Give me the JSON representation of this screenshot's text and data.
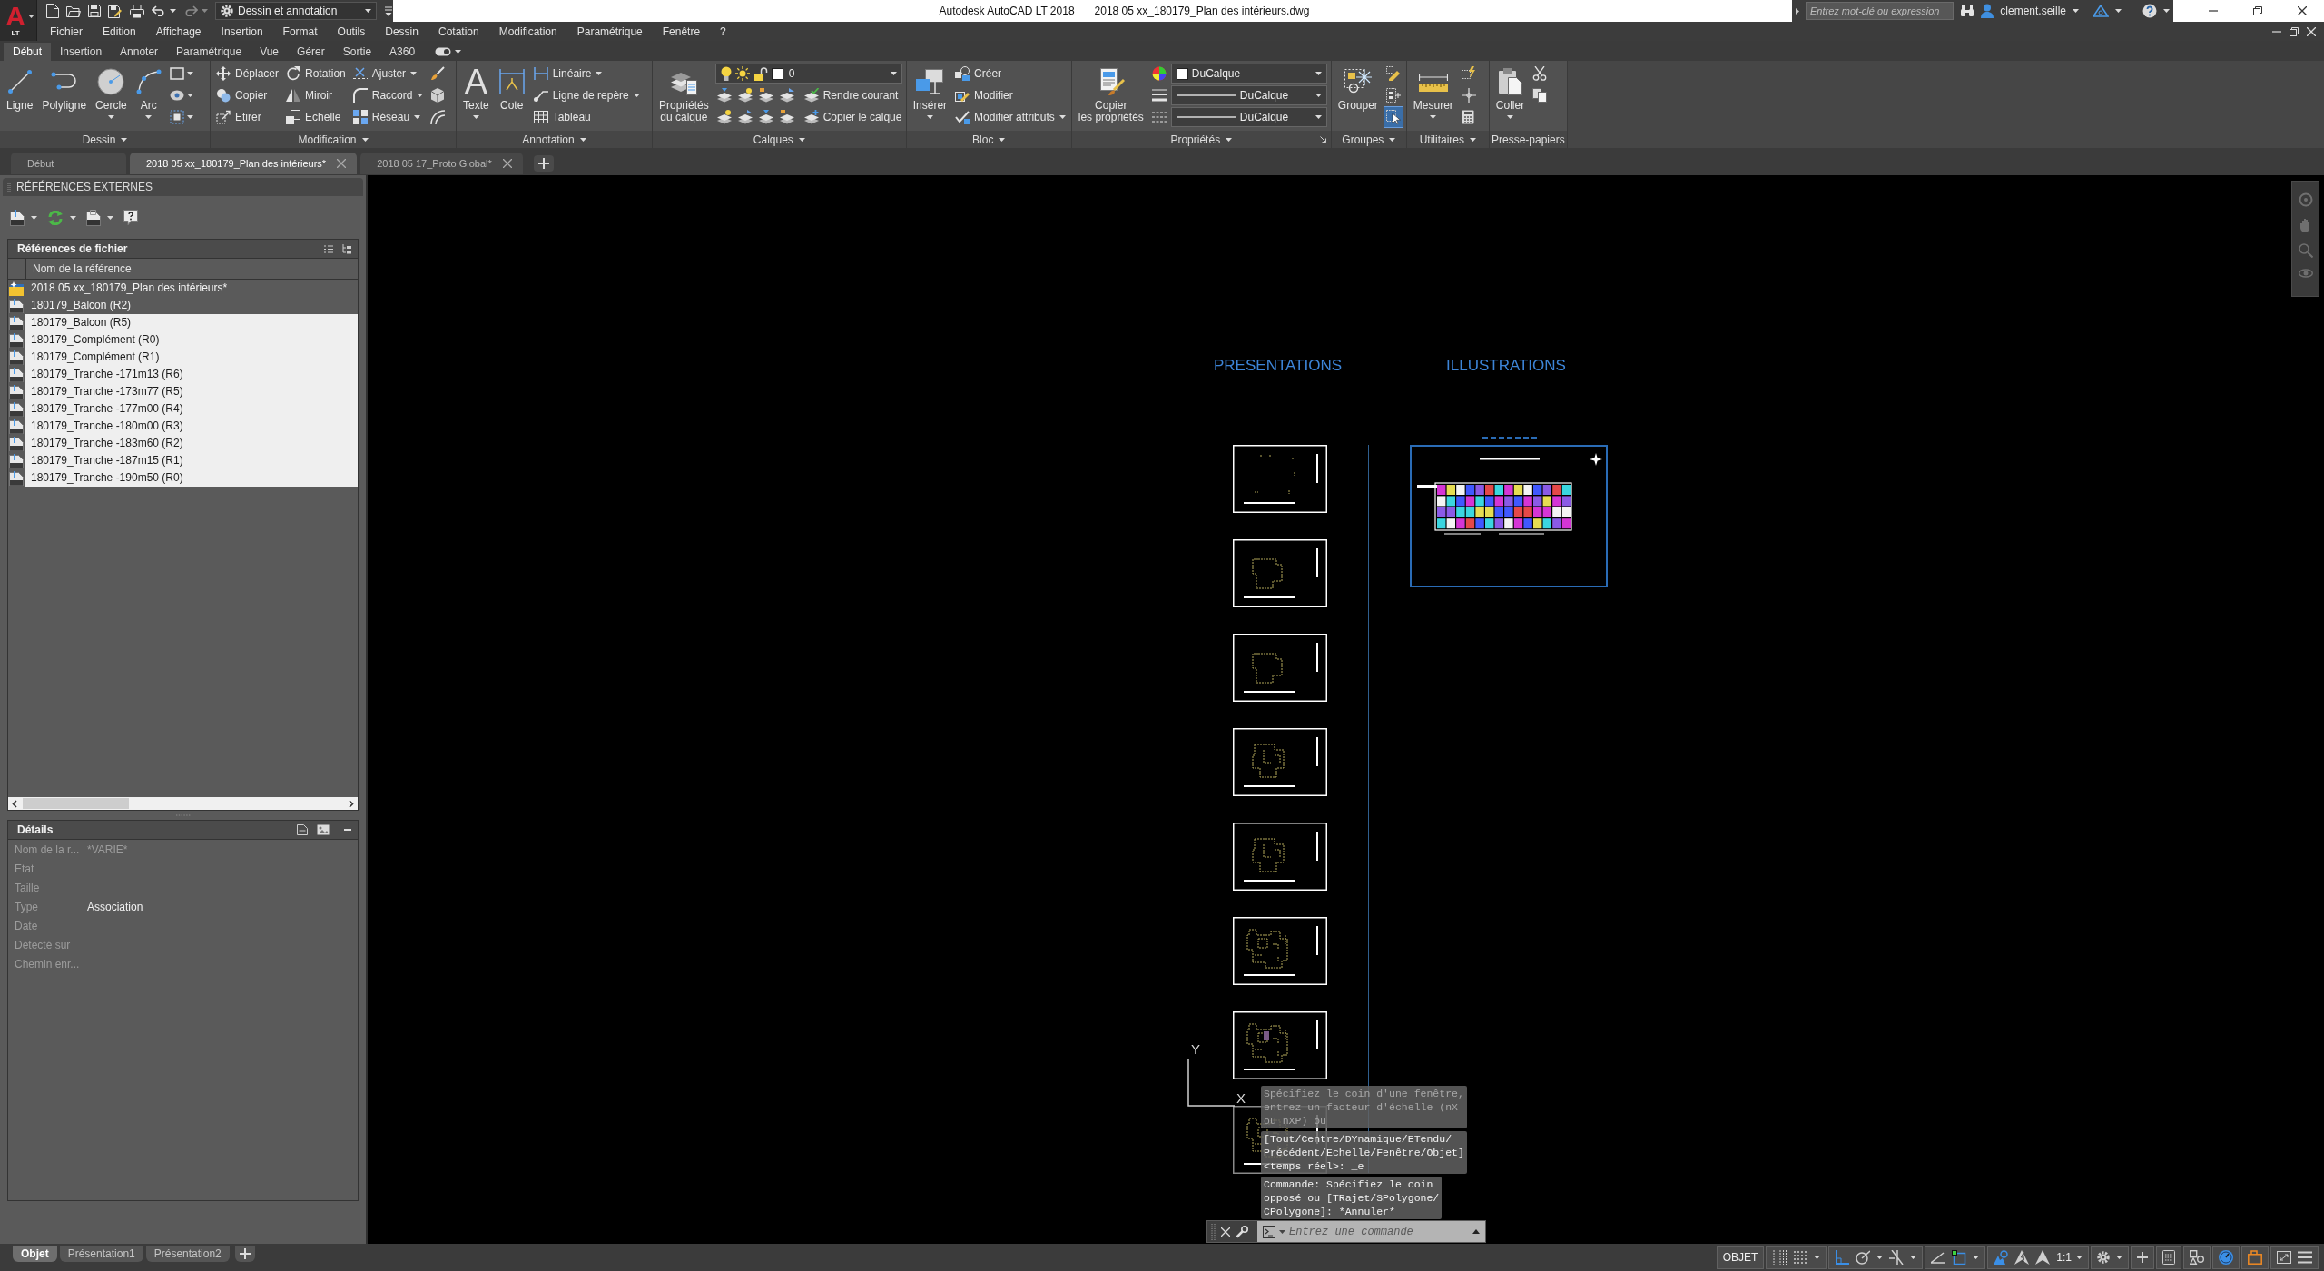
{
  "app_button": {
    "letter": "A",
    "edition": "LT"
  },
  "title_bar": {
    "workspace": "Dessin et annotation",
    "application": "Autodesk AutoCAD LT 2018",
    "document": "2018 05 xx_180179_Plan des intérieurs.dwg",
    "search": {
      "placeholder": "Entrez mot-clé ou expression"
    },
    "user": "clement.seille"
  },
  "menu_bar": [
    "Fichier",
    "Edition",
    "Affichage",
    "Insertion",
    "Format",
    "Outils",
    "Dessin",
    "Cotation",
    "Modification",
    "Paramétrique",
    "Fenêtre",
    "?"
  ],
  "ribbon_tabs": [
    {
      "label": "Début",
      "selected": true
    },
    {
      "label": "Insertion",
      "selected": false
    },
    {
      "label": "Annoter",
      "selected": false
    },
    {
      "label": "Paramétrique",
      "selected": false
    },
    {
      "label": "Vue",
      "selected": false
    },
    {
      "label": "Gérer",
      "selected": false
    },
    {
      "label": "Sortie",
      "selected": false
    },
    {
      "label": "A360",
      "selected": false
    }
  ],
  "ribbon_panels": [
    {
      "title": "Dessin",
      "menu": true,
      "launcher": false,
      "items": [
        {
          "kind": "large",
          "label": "Ligne",
          "dropdown": false
        },
        {
          "kind": "large",
          "label": "Polyligne",
          "dropdown": false
        },
        {
          "kind": "large",
          "label": "Cercle",
          "dropdown": true
        },
        {
          "kind": "large",
          "label": "Arc",
          "dropdown": true
        },
        {
          "kind": "tools",
          "items": [
            {
              "dropdown": true,
              "on": false
            },
            {
              "dropdown": true,
              "on": false
            },
            {
              "dropdown": true,
              "on": false
            }
          ]
        }
      ]
    },
    {
      "title": "Modification",
      "menu": true,
      "launcher": false,
      "items": [
        {
          "kind": "column",
          "buttons": [
            {
              "label": "Déplacer",
              "dropdown": false
            },
            {
              "label": "Copier",
              "dropdown": false
            },
            {
              "label": "Etirer",
              "dropdown": false
            }
          ]
        },
        {
          "kind": "column",
          "buttons": [
            {
              "label": "Rotation",
              "dropdown": false
            },
            {
              "label": "Miroir",
              "dropdown": false
            },
            {
              "label": "Echelle",
              "dropdown": false
            }
          ]
        },
        {
          "kind": "column",
          "buttons": [
            {
              "label": "Ajuster",
              "dropdown": true
            },
            {
              "label": "Raccord",
              "dropdown": true
            },
            {
              "label": "Réseau",
              "dropdown": true
            }
          ]
        },
        {
          "kind": "tools",
          "items": [
            {
              "dropdown": false,
              "on": false
            },
            {
              "dropdown": false,
              "on": false
            },
            {
              "dropdown": false,
              "on": false
            }
          ]
        }
      ]
    },
    {
      "title": "Annotation",
      "menu": true,
      "launcher": false,
      "items": [
        {
          "kind": "large",
          "label": "Texte",
          "glyph": "A",
          "dropdown": true
        },
        {
          "kind": "large",
          "label": "Cote",
          "dropdown": false
        },
        {
          "kind": "column",
          "buttons": [
            {
              "label": "Linéaire",
              "dropdown": true
            },
            {
              "label": "Ligne de repère",
              "dropdown": true
            },
            {
              "label": "Tableau",
              "dropdown": false
            }
          ]
        }
      ]
    },
    {
      "title": "Calques",
      "menu": true,
      "launcher": false,
      "items": [
        {
          "kind": "large",
          "label": "Propriétés\ndu calque",
          "dropdown": false
        },
        {
          "kind": "layer",
          "current": "0",
          "actions": [
            "Rendre courant",
            "Copier le calque"
          ]
        }
      ]
    },
    {
      "title": "Bloc",
      "menu": true,
      "launcher": false,
      "items": [
        {
          "kind": "large",
          "label": "Insérer",
          "dropdown": true
        },
        {
          "kind": "column",
          "buttons": [
            {
              "label": "Créer",
              "dropdown": false
            },
            {
              "label": "Modifier",
              "dropdown": false
            },
            {
              "label": "Modifier attributs",
              "dropdown": true
            }
          ]
        }
      ]
    },
    {
      "title": "Propriétés",
      "menu": true,
      "launcher": true,
      "items": [
        {
          "kind": "large",
          "label": "Copier\nles propriétés",
          "dropdown": false
        },
        {
          "kind": "properties",
          "combos": [
            {
              "kind": "color",
              "value": "DuCalque"
            },
            {
              "kind": "lineweight",
              "value": "DuCalque"
            },
            {
              "kind": "linetype",
              "value": "DuCalque"
            }
          ]
        }
      ]
    },
    {
      "title": "Groupes",
      "menu": true,
      "launcher": false,
      "items": [
        {
          "kind": "large",
          "label": "Grouper",
          "dropdown": false
        },
        {
          "kind": "tools",
          "items": [
            {
              "dropdown": false,
              "on": false
            },
            {
              "dropdown": false,
              "on": false
            },
            {
              "dropdown": false,
              "on": true
            }
          ]
        }
      ]
    },
    {
      "title": "Utilitaires",
      "menu": true,
      "launcher": false,
      "items": [
        {
          "kind": "large",
          "label": "Mesurer",
          "dropdown": true
        },
        {
          "kind": "tools",
          "items": [
            {
              "dropdown": false,
              "on": false
            },
            {
              "dropdown": false,
              "on": false
            },
            {
              "dropdown": false,
              "on": false
            }
          ]
        }
      ]
    },
    {
      "title": "Presse-papiers",
      "menu": false,
      "launcher": false,
      "items": [
        {
          "kind": "large",
          "label": "Coller",
          "dropdown": true
        },
        {
          "kind": "tools",
          "items": [
            {
              "dropdown": false,
              "on": false
            },
            {
              "dropdown": false,
              "on": false
            }
          ]
        }
      ]
    }
  ],
  "document_tabs": [
    {
      "label": "Début",
      "selected": false,
      "closable": false
    },
    {
      "label": "2018 05 xx_180179_Plan des intérieurs*",
      "selected": true,
      "closable": true
    },
    {
      "label": "2018 05 17_Proto Global*",
      "selected": false,
      "closable": true
    }
  ],
  "xref_palette": {
    "title": "RÉFÉRENCES EXTERNES",
    "file_references": {
      "title": "Références de fichier",
      "column": "Nom de la référence",
      "rows": [
        {
          "name": "2018 05 xx_180179_Plan des intérieurs*",
          "kind": "host",
          "selected": false
        },
        {
          "name": "180179_Balcon (R2)",
          "kind": "dwg",
          "selected": false
        },
        {
          "name": "180179_Balcon (R5)",
          "kind": "dwg",
          "selected": true
        },
        {
          "name": "180179_Complément (R0)",
          "kind": "dwg",
          "selected": true
        },
        {
          "name": "180179_Complément (R1)",
          "kind": "dwg",
          "selected": true
        },
        {
          "name": "180179_Tranche -171m13 (R6)",
          "kind": "dwg",
          "selected": true
        },
        {
          "name": "180179_Tranche -173m77 (R5)",
          "kind": "dwg",
          "selected": true
        },
        {
          "name": "180179_Tranche -177m00 (R4)",
          "kind": "dwg",
          "selected": true
        },
        {
          "name": "180179_Tranche -180m00 (R3)",
          "kind": "dwg",
          "selected": true
        },
        {
          "name": "180179_Tranche -183m60 (R2)",
          "kind": "dwg",
          "selected": true
        },
        {
          "name": "180179_Tranche -187m15 (R1)",
          "kind": "dwg",
          "selected": true
        },
        {
          "name": "180179_Tranche -190m50 (R0)",
          "kind": "dwg",
          "selected": true
        }
      ]
    },
    "details": {
      "title": "Détails",
      "rows": [
        {
          "label": "Nom de la r...",
          "value": {
            "text": "*VARIE*",
            "disabled": true
          }
        },
        {
          "label": "Etat"
        },
        {
          "label": "Taille"
        },
        {
          "label": "Type",
          "value": {
            "text": "Association",
            "disabled": false
          }
        },
        {
          "label": "Date"
        },
        {
          "label": "Détecté sur"
        },
        {
          "label": "Chemin enr..."
        }
      ]
    }
  },
  "drawing": {
    "headings": [
      "PRESENTATIONS",
      "ILLUSTRATIONS"
    ],
    "ucs": {
      "x": "X",
      "y": "Y"
    },
    "command_history": [
      {
        "lines": [
          "Spécifiez le coin d'une fenêtre,",
          "entrez un facteur d'échelle (nX",
          "ou nXP) ou"
        ],
        "dimmed": true
      },
      {
        "lines": [
          "[Tout/Centre/DYnamique/ETendu/",
          "Précédent/Echelle/Fenêtre/Objet]",
          "<temps réel>: _e"
        ],
        "dimmed": false
      },
      {
        "lines": [
          "Commande: Spécifiez le coin",
          "opposé ou [TRajet/SPolygone/",
          "CPolygone]: *Annuler*"
        ],
        "dimmed": false
      }
    ],
    "command_line": {
      "placeholder": "Entrez une commande"
    }
  },
  "layout_tabs": [
    {
      "label": "Objet",
      "selected": true
    },
    {
      "label": "Présentation1",
      "selected": false
    },
    {
      "label": "Présentation2",
      "selected": false
    }
  ],
  "status_bar": {
    "space": "OBJET",
    "scale": "1:1",
    "tools": [
      {
        "on": false
      },
      {
        "on": false
      },
      {
        "on": true
      },
      {
        "on": false
      },
      {
        "on": false
      },
      {
        "on": false
      },
      {
        "on": true
      },
      {
        "on": true
      },
      {
        "on": false
      },
      {
        "on": false
      },
      {
        "on": false
      },
      {
        "on": false
      },
      {
        "on": false
      },
      {
        "on": false
      },
      {
        "on": true
      },
      {
        "on": false
      },
      {
        "on": false
      },
      {
        "on": false
      }
    ]
  }
}
